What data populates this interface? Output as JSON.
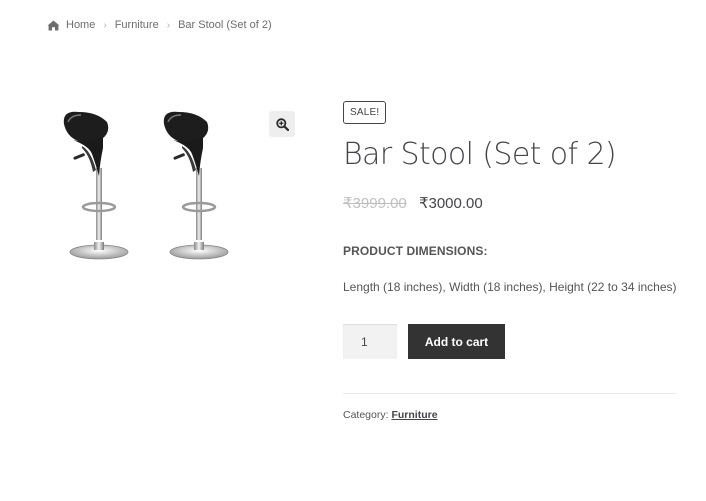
{
  "breadcrumb": {
    "home": "Home",
    "category": "Furniture",
    "current": "Bar Stool (Set of 2)",
    "separator": "›"
  },
  "gallery": {
    "zoom_icon": "magnifier-plus-icon"
  },
  "product": {
    "sale_badge": "SALE!",
    "title": "Bar Stool (Set of 2)",
    "price_regular": "₹3999.00",
    "price_sale": "₹3000.00",
    "dimensions_heading": "PRODUCT DIMENSIONS:",
    "dimensions_text": "Length (18 inches), Width (18 inches), Height (22 to 34 inches)"
  },
  "cart": {
    "quantity": "1",
    "add_button": "Add to cart"
  },
  "meta": {
    "category_label": "Category:",
    "category_value": "Furniture"
  }
}
